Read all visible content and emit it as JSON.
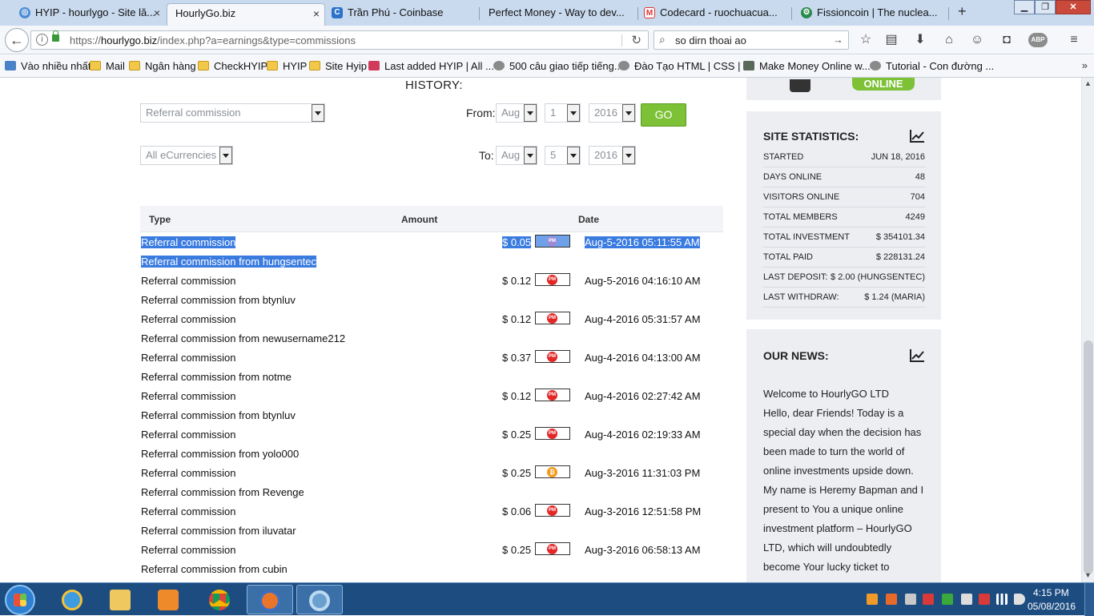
{
  "browser": {
    "tabs": [
      {
        "label": "HYIP - hourlygo - Site lă...",
        "icon": "search-globe-icon",
        "active": false
      },
      {
        "label": "HourlyGo.biz",
        "icon": "",
        "active": true
      },
      {
        "label": "Trần Phú - Coinbase",
        "icon": "coinbase-icon",
        "active": false
      },
      {
        "label": "Perfect Money - Way to dev...",
        "icon": "",
        "active": false
      },
      {
        "label": "Codecard - ruochuacua...",
        "icon": "gmail-icon",
        "active": false
      },
      {
        "label": "Fissioncoin | The nuclea...",
        "icon": "fissioncoin-icon",
        "active": false
      }
    ],
    "new_tab": "+",
    "url_prefix": "https://",
    "url_domain": "hourlygo.biz",
    "url_rest": "/index.php?a=earnings&type=commissions",
    "search_query": "so dirn thoai ao",
    "bookmarks": [
      {
        "label": "Vào nhiều nhất",
        "icon": "bookmark-star-icon"
      },
      {
        "label": "Mail",
        "icon": "folder-icon"
      },
      {
        "label": "Ngân hàng",
        "icon": "folder-icon"
      },
      {
        "label": "CheckHYIP",
        "icon": "folder-icon"
      },
      {
        "label": "HYIP",
        "icon": "folder-icon"
      },
      {
        "label": "Site Hyip",
        "icon": "folder-icon"
      },
      {
        "label": "Last added HYIP | All ...",
        "icon": "a-logo-icon"
      },
      {
        "label": "500 câu giao tiếp tiếng...",
        "icon": "globe-icon"
      },
      {
        "label": "Đào Tạo HTML | CSS | ...",
        "icon": "globe-icon"
      },
      {
        "label": "Make Money Online w...",
        "icon": "site-icon"
      },
      {
        "label": "Tutorial - Con đường ...",
        "icon": "globe-icon"
      }
    ],
    "bookmarks_more": "»"
  },
  "page": {
    "history_title": "HISTORY:",
    "filters": {
      "type_value": "Referral commission",
      "currency_value": "All eCurrencies",
      "from_label": "From:",
      "to_label": "To:",
      "from_month": "Aug",
      "from_day": "1",
      "from_year": "2016",
      "to_month": "Aug",
      "to_day": "5",
      "to_year": "2016",
      "go_label": "GO"
    },
    "table": {
      "headers": [
        "Type",
        "Amount",
        "Date"
      ],
      "rows": [
        {
          "type": "Referral commission",
          "amount": "$ 0.05",
          "currency": "PM",
          "date": "Aug-5-2016 05:11:55 AM",
          "from": "Referral commission from hungsentec",
          "selected": true
        },
        {
          "type": "Referral commission",
          "amount": "$ 0.12",
          "currency": "PM",
          "date": "Aug-5-2016 04:16:10 AM",
          "from": "Referral commission from btynluv",
          "selected": false
        },
        {
          "type": "Referral commission",
          "amount": "$ 0.12",
          "currency": "PM",
          "date": "Aug-4-2016 05:31:57 AM",
          "from": "Referral commission from newusername212",
          "selected": false
        },
        {
          "type": "Referral commission",
          "amount": "$ 0.37",
          "currency": "PM",
          "date": "Aug-4-2016 04:13:00 AM",
          "from": "Referral commission from notme",
          "selected": false
        },
        {
          "type": "Referral commission",
          "amount": "$ 0.12",
          "currency": "PM",
          "date": "Aug-4-2016 02:27:42 AM",
          "from": "Referral commission from btynluv",
          "selected": false
        },
        {
          "type": "Referral commission",
          "amount": "$ 0.25",
          "currency": "PM",
          "date": "Aug-4-2016 02:19:33 AM",
          "from": "Referral commission from yolo000",
          "selected": false
        },
        {
          "type": "Referral commission",
          "amount": "$ 0.25",
          "currency": "BTC",
          "date": "Aug-3-2016 11:31:03 PM",
          "from": "Referral commission from Revenge",
          "selected": false
        },
        {
          "type": "Referral commission",
          "amount": "$ 0.06",
          "currency": "PM",
          "date": "Aug-3-2016 12:51:58 PM",
          "from": "Referral commission from iluvatar",
          "selected": false
        },
        {
          "type": "Referral commission",
          "amount": "$ 0.25",
          "currency": "PM",
          "date": "Aug-3-2016 06:58:13 AM",
          "from": "Referral commission from cubin",
          "selected": false
        }
      ]
    }
  },
  "sidebar": {
    "online_label": "ONLINE",
    "stats_title": "SITE STATISTICS:",
    "stats": [
      {
        "label": "STARTED",
        "value": "JUN 18, 2016"
      },
      {
        "label": "DAYS ONLINE",
        "value": "48"
      },
      {
        "label": "VISITORS ONLINE",
        "value": "704"
      },
      {
        "label": "TOTAL MEMBERS",
        "value": "4249"
      },
      {
        "label": "TOTAL INVESTMENT",
        "value": "$ 354101.34"
      },
      {
        "label": "TOTAL PAID",
        "value": "$ 228131.24"
      },
      {
        "label": "LAST DEPOSIT:",
        "value": "$ 2.00 (HUNGSENTEC)"
      },
      {
        "label": "LAST WITHDRAW:",
        "value": "$ 1.24 (MARIA)"
      }
    ],
    "news_title": "OUR NEWS:",
    "news_lines": [
      "Welcome to HourlyGO LTD",
      "Hello, dear Friends! Today is a",
      "special day when the decision has",
      "been made to turn the world of",
      "online investments upside down.",
      "My name is Heremy Bapman and I",
      "present to You a unique online",
      "investment platform – HourlyGO",
      "LTD, which will undoubtedly",
      "become Your lucky ticket to"
    ]
  },
  "taskbar": {
    "time": "4:15 PM",
    "date": "05/08/2016"
  },
  "colors": {
    "accent_green": "#7dc136",
    "pm_red": "#e32626",
    "btc_orange": "#f39b1a",
    "selection_blue": "#3a7be0",
    "taskbar_blue": "#1c4c80"
  }
}
